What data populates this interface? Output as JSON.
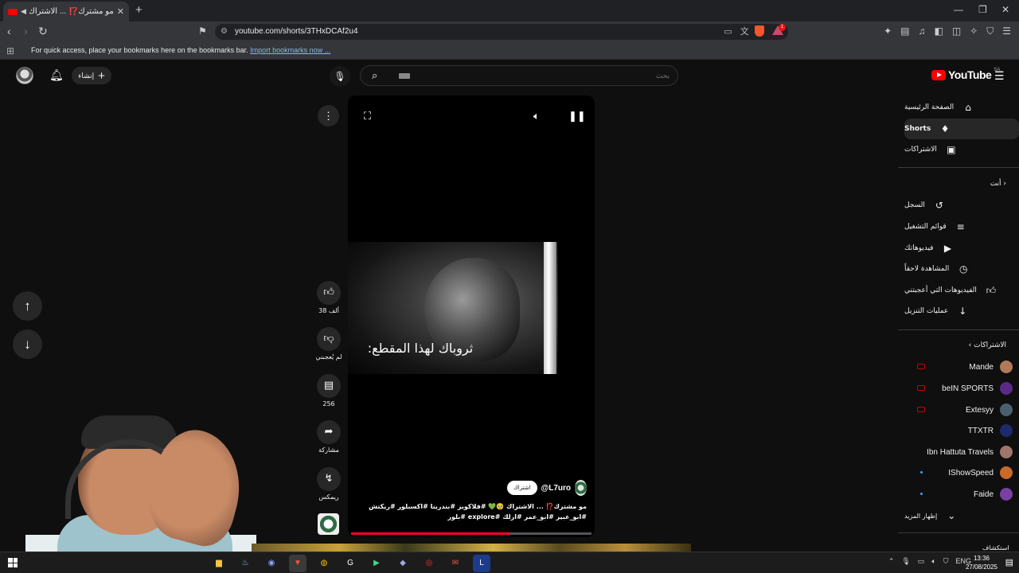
{
  "browser": {
    "tab_title": "مو مشترك⁉️ ... الاشتراك 🥹💚🤍",
    "url": "youtube.com/shorts/3THxDCAf2u4",
    "bookmarks_msg": "For quick access, place your bookmarks here on the bookmarks bar.",
    "bookmarks_link": "Import bookmarks now ..."
  },
  "header": {
    "create_label": "إنشاء",
    "search_placeholder": "بحث",
    "logo_text": "YouTube",
    "logo_country": "SA"
  },
  "sidebar": {
    "nav": [
      {
        "label": "الصفحة الرئيسية",
        "icon": "home-icon",
        "glyph": "⌂"
      },
      {
        "label": "Shorts",
        "icon": "shorts-icon",
        "glyph": "♦"
      },
      {
        "label": "الاشتراكات",
        "icon": "subscriptions-icon",
        "glyph": "▣"
      }
    ],
    "you_header": "أنت",
    "you_items": [
      {
        "label": "السجل",
        "icon": "history-icon",
        "glyph": "↺"
      },
      {
        "label": "قوائم التشغيل",
        "icon": "playlists-icon",
        "glyph": "≡"
      },
      {
        "label": "فيديوهاتك",
        "icon": "your-videos-icon",
        "glyph": "▶"
      },
      {
        "label": "المشاهدة لاحقاً",
        "icon": "watch-later-icon",
        "glyph": "◷"
      },
      {
        "label": "الفيديوهات التي أعجبتني",
        "icon": "liked-videos-icon",
        "glyph": "👍"
      },
      {
        "label": "عمليات التنزيل",
        "icon": "downloads-icon",
        "glyph": "↓"
      }
    ],
    "subs_header": "الاشتراكات",
    "subscriptions": [
      {
        "name": "Mande",
        "color": "#b07a5a",
        "indicator": "live"
      },
      {
        "name": "beIN SPORTS",
        "color": "#5b2a86",
        "indicator": "live"
      },
      {
        "name": "Extesyy",
        "color": "#4a6070",
        "indicator": "live"
      },
      {
        "name": "TTXTR",
        "color": "#1d2a6b",
        "indicator": "none"
      },
      {
        "name": "Ibn Hattuta Travels",
        "color": "#a0756a",
        "indicator": "none"
      },
      {
        "name": "IShowSpeed",
        "color": "#c76a2a",
        "indicator": "dot"
      },
      {
        "name": "Faide",
        "color": "#7a3fa0",
        "indicator": "dot"
      }
    ],
    "show_more": "إظهار المزيد",
    "explore_header": "استكشاف"
  },
  "video": {
    "overlay_text": "ثروباك لهذا المقطع:",
    "channel": "@L7uro",
    "subscribe_label": "اشتراك",
    "description": "مو مشترك⁉️ ... الاشتراك 🥹💚 #فلاكويز #بندرينا #اكسبلور #ريكتش #ابو_عبير #ابو_عمر #ازلك #explore #بلور",
    "progress": 0.66
  },
  "actions": {
    "likes": "38 ألف",
    "dislike_label": "لم يُعجبني",
    "comments": "256",
    "share_label": "مشاركة",
    "remix_label": "ريمكس"
  },
  "taskbar": {
    "lang": "ENG",
    "time": "13:36",
    "date": "27/08/2025"
  }
}
